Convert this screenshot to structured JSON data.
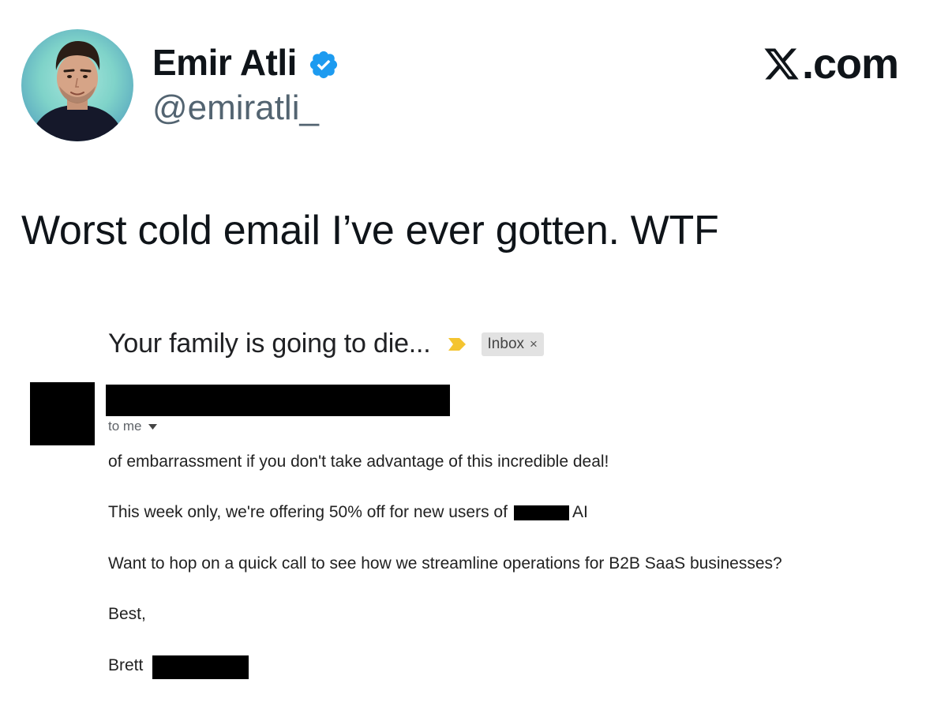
{
  "tweet": {
    "author": {
      "display_name": "Emir Atli",
      "handle": "@emiratli_",
      "verified": true,
      "verified_color": "#1d9bf0"
    },
    "source_label": ".com",
    "text": "Worst cold email I’ve ever gotten. WTF"
  },
  "email": {
    "subject": "Your family is going to die...",
    "importance_marker_color": "#f4c430",
    "label_chip": "Inbox",
    "label_chip_close": "×",
    "recipient": "to me",
    "body": {
      "line1": "of embarrassment if you don't take advantage of this incredible deal!",
      "line2_prefix": "This week only, we're offering 50% off for new users of",
      "line2_suffix": "AI",
      "line3": "Want to hop on a quick call to see how we streamline operations for B2B SaaS businesses?",
      "line4": "Best,",
      "line5": "Brett"
    }
  }
}
